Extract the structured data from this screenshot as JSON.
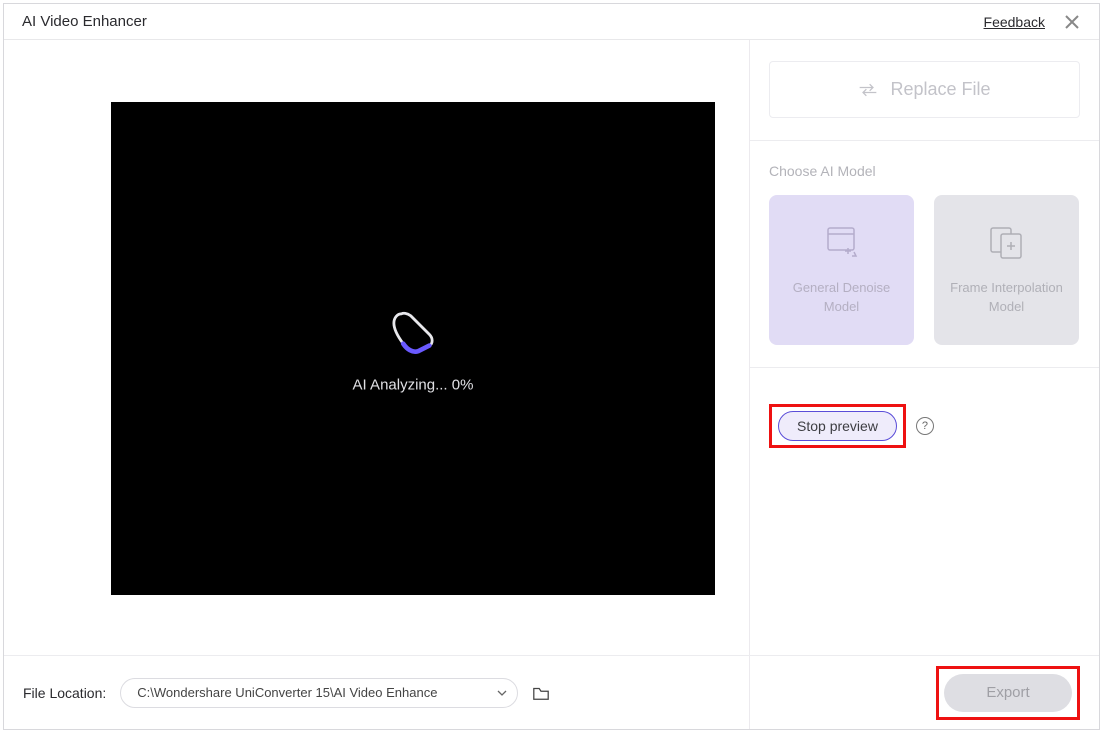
{
  "titlebar": {
    "title": "AI Video Enhancer",
    "feedback": "Feedback"
  },
  "video": {
    "status": "AI Analyzing... 0%"
  },
  "sidebar": {
    "replace_label": "Replace File",
    "choose_model_label": "Choose AI Model",
    "models": [
      {
        "label": "General Denoise Model"
      },
      {
        "label": "Frame Interpolation Model"
      }
    ],
    "stop_preview_label": "Stop preview",
    "help_label": "?"
  },
  "footer": {
    "file_location_label": "File Location:",
    "file_path": "C:\\Wondershare UniConverter 15\\AI Video Enhance",
    "export_label": "Export"
  }
}
